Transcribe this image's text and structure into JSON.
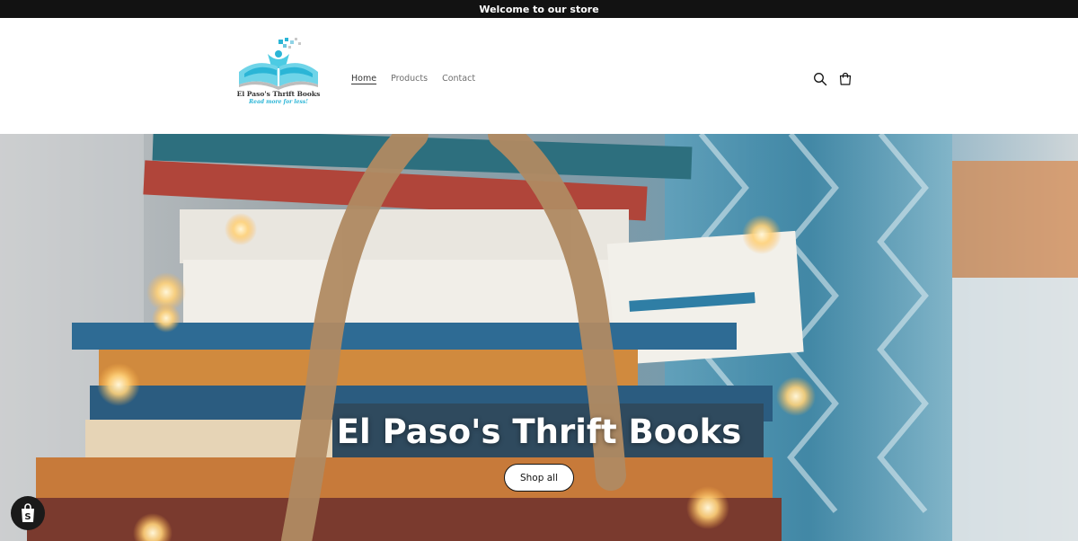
{
  "announcement": {
    "text": "Welcome to our store"
  },
  "logo": {
    "name": "El Paso's Thrift Books",
    "tagline": "Read more for less!"
  },
  "nav": {
    "items": [
      {
        "label": "Home",
        "active": true
      },
      {
        "label": "Products",
        "active": false
      },
      {
        "label": "Contact",
        "active": false
      }
    ]
  },
  "header_icons": [
    "search-icon",
    "cart-icon"
  ],
  "hero": {
    "title": "El Paso's Thrift Books",
    "button_label": "Shop all"
  },
  "floating": {
    "badge": "shopify-bag-icon"
  },
  "colors": {
    "announcement_bg": "#121212",
    "logo_accent": "#2bb5d6",
    "button_border": "#121212"
  }
}
